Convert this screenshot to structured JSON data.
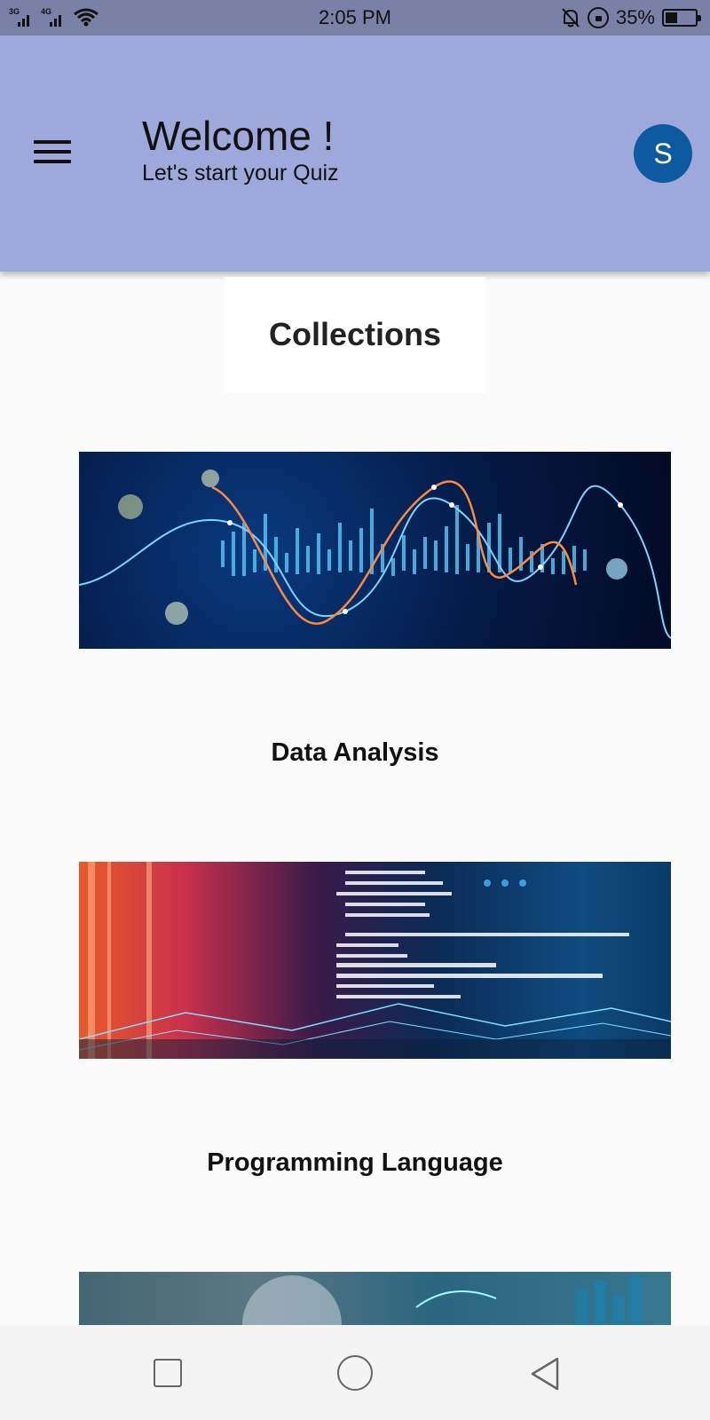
{
  "status_bar": {
    "signal1": "3G",
    "signal2": "4G",
    "time": "2:05 PM",
    "battery": "35%",
    "battery_level": 0.35
  },
  "header": {
    "title": "Welcome !",
    "subtitle": "Let's start your Quiz",
    "avatar_initial": "S",
    "avatar_color": "#0d5aa0",
    "background_color": "#9fa8da"
  },
  "collections": {
    "heading": "Collections",
    "items": [
      {
        "title": "Data Analysis",
        "image": "data-analysis-chart-image"
      },
      {
        "title": "Programming Language",
        "image": "programming-code-image"
      },
      {
        "title": "",
        "image": "ai-technology-image"
      }
    ]
  },
  "nav_bar": {
    "icons": [
      "recent-apps-icon",
      "home-icon",
      "back-icon"
    ]
  }
}
